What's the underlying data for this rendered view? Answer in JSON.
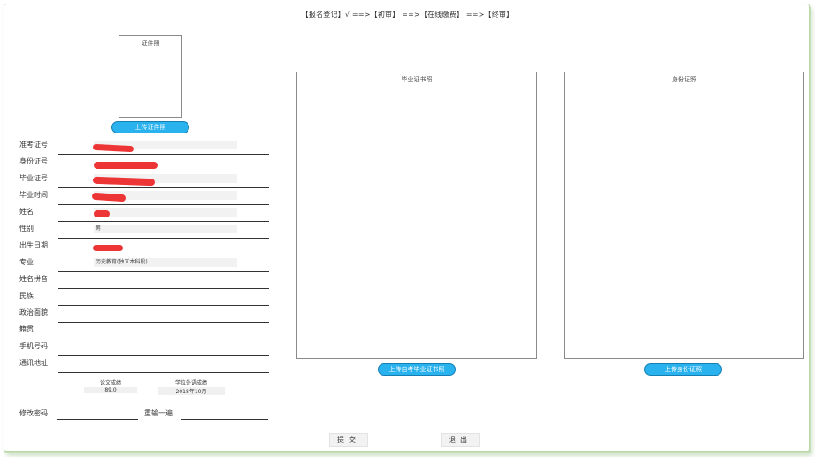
{
  "steps": "【报名登记】√ ==>【初审】 ==>【在线缴费】 ==>【终审】",
  "photo": {
    "caption": "证件照",
    "upload_label": "上传证件照"
  },
  "diploma": {
    "caption": "毕业证书照",
    "upload_label": "上传自考毕业证书照"
  },
  "idcard": {
    "caption": "身份证照",
    "upload_label": "上传身份证照"
  },
  "fields": [
    {
      "label": "准考证号",
      "value": ""
    },
    {
      "label": "身份证号",
      "value": ""
    },
    {
      "label": "毕业证号",
      "value": ""
    },
    {
      "label": "毕业时间",
      "value": ""
    },
    {
      "label": "姓名",
      "value": ""
    },
    {
      "label": "性别",
      "value": "男"
    },
    {
      "label": "出生日期",
      "value": ""
    },
    {
      "label": "专业",
      "value": "历史教育(独立本科段)"
    },
    {
      "label": "姓名拼音",
      "value": ""
    },
    {
      "label": "民族",
      "value": ""
    },
    {
      "label": "政治面貌",
      "value": ""
    },
    {
      "label": "籍贯",
      "value": ""
    },
    {
      "label": "手机号码",
      "value": ""
    },
    {
      "label": "通讯地址",
      "value": ""
    }
  ],
  "scores": {
    "thesis_label": "论文成绩",
    "thesis_value": "89.0",
    "degree_label": "学位外语成绩",
    "degree_value": "2018年10月"
  },
  "password": {
    "label": "修改密码",
    "confirm_label": "重输一遍"
  },
  "buttons": {
    "submit": "提交",
    "exit": "退出"
  },
  "colors": {
    "upload_button": "#29b2ee",
    "redaction": "#ee3535",
    "frame_border": "#b9d8a6"
  }
}
